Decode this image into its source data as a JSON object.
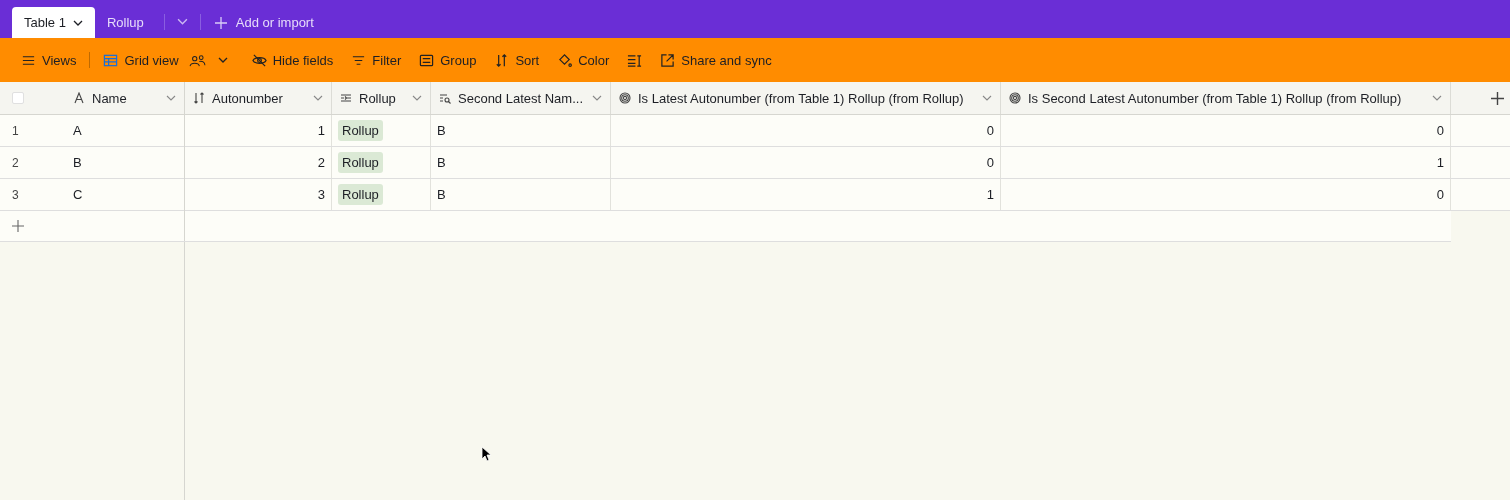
{
  "tabs": [
    {
      "label": "Table 1",
      "selected": true
    },
    {
      "label": "Rollup",
      "selected": false
    }
  ],
  "add_tab": {
    "label": "Add or import"
  },
  "select_all": {
    "checked": false
  },
  "toolbar": [
    {
      "kind": "views",
      "label": "Views"
    },
    {
      "kind": "grid",
      "label": "Grid view"
    },
    {
      "kind": "hide",
      "label": "Hide fields"
    },
    {
      "kind": "filter",
      "label": "Filter"
    },
    {
      "kind": "group",
      "label": "Group"
    },
    {
      "kind": "sort",
      "label": "Sort"
    },
    {
      "kind": "color",
      "label": "Color"
    },
    {
      "kind": "height"
    },
    {
      "kind": "share",
      "label": "Share and sync"
    }
  ],
  "columns": [
    {
      "kind": "text",
      "label": "Name"
    },
    {
      "kind": "autonumber",
      "label": "Autonumber"
    },
    {
      "kind": "rollup",
      "label": "Rollup"
    },
    {
      "kind": "lookup",
      "label": "Second Latest Nam..."
    },
    {
      "kind": "formula",
      "label": "Is Latest Autonumber (from Table 1) Rollup (from Rollup)"
    },
    {
      "kind": "formula",
      "label": "Is Second Latest Autonumber (from Table 1) Rollup (from Rollup)"
    }
  ],
  "rows": [
    {
      "number": "1",
      "cells": [
        "A",
        "1",
        "Rollup",
        "B",
        "0",
        "0"
      ]
    },
    {
      "number": "2",
      "cells": [
        "B",
        "2",
        "Rollup",
        "B",
        "0",
        "1"
      ]
    },
    {
      "number": "3",
      "cells": [
        "C",
        "3",
        "Rollup",
        "B",
        "1",
        "0"
      ]
    }
  ]
}
